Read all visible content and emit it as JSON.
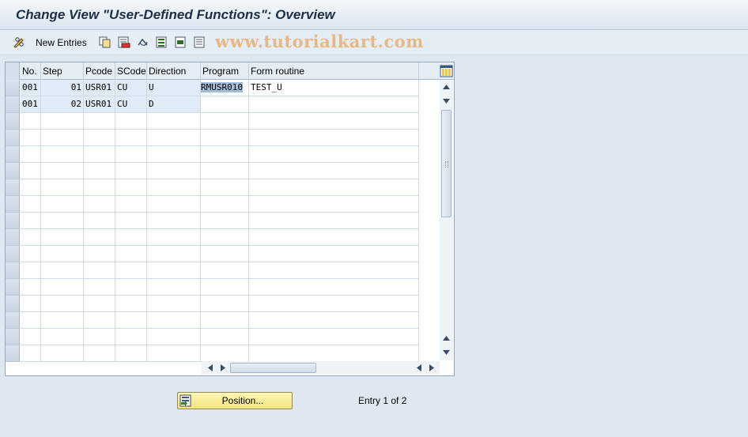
{
  "title": "Change View \"User-Defined Functions\": Overview",
  "toolbar": {
    "new_entries_label": "New Entries",
    "watermark": "www.tutorialkart.com",
    "icons": [
      "pencil-glasses-icon",
      "copy-icon",
      "delete-icon",
      "undo-icon",
      "select-all-icon",
      "select-block-icon",
      "deselect-all-icon"
    ]
  },
  "table": {
    "columns": [
      "No.",
      "Step",
      "Pcode",
      "SCode",
      "Direction",
      "Program",
      "Form routine"
    ],
    "rows": [
      {
        "no": "001",
        "step": "01",
        "pcode": "USR01",
        "scode": "CU",
        "direction": "U",
        "program": "RMUSR010",
        "form_routine": "TEST_U"
      },
      {
        "no": "001",
        "step": "02",
        "pcode": "USR01",
        "scode": "CU",
        "direction": "D",
        "program": "",
        "form_routine": ""
      }
    ]
  },
  "footer": {
    "position_label": "Position...",
    "entry_info": "Entry 1 of 2"
  },
  "colors": {
    "background": "#dfe8f1",
    "readonly_cell": "#e1ebf5",
    "position_button": "#f3e27a",
    "watermark": "#eb963c"
  }
}
